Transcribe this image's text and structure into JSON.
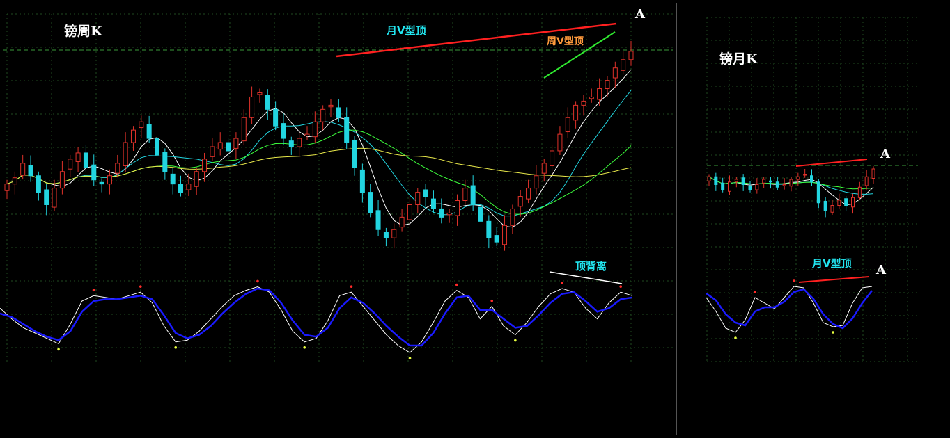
{
  "colors": {
    "background": "#000000",
    "grid": "#1f4a1f",
    "divider": "#8c8c8c",
    "dashed_level": "#3a9a3a",
    "up_candle": "#e0322a",
    "down_candle": "#22d5e0",
    "ma_colors": [
      "#ffffff",
      "#22d5e0",
      "#3dff3d",
      "#e8e84a",
      "#2aa0ff"
    ],
    "osc_fast": "#ffffff",
    "osc_slow": "#1a1aff",
    "red_trend": "#ff2020",
    "green_trend": "#30e830",
    "white_trend": "#ffffff",
    "dot_red": "#ff2a2a",
    "dot_yellow": "#e8ff40"
  },
  "labels": {
    "weekly_title": "镑周K",
    "monthly_title": "镑月K",
    "month_v_top": "月V型顶",
    "week_v_top": "周V型顶",
    "top_divergence": "顶背离",
    "month_v_top_right": "月V型顶",
    "point_a_weekly": "A",
    "point_a_monthly": "A",
    "point_a_monthly_osc": "A"
  },
  "chart_data": [
    {
      "type": "candlestick",
      "title": "镑周K",
      "annotations": [
        "月V型顶",
        "周V型顶",
        "顶背离",
        "A"
      ],
      "series": [
        {
          "name": "candles",
          "close_path": [
            40,
            43,
            50,
            44,
            36,
            30,
            38,
            46,
            52,
            55,
            48,
            42,
            40,
            44,
            50,
            60,
            66,
            70,
            62,
            54,
            46,
            40,
            36,
            40,
            46,
            52,
            58,
            60,
            56,
            62,
            72,
            82,
            84,
            76,
            68,
            62,
            58,
            62,
            64,
            70,
            76,
            78,
            72,
            60,
            48,
            36,
            26,
            18,
            14,
            18,
            24,
            30,
            36,
            34,
            28,
            24,
            26,
            32,
            38,
            30,
            22,
            14,
            12,
            20,
            28,
            34,
            38,
            44,
            50,
            56,
            64,
            72,
            78,
            80,
            82,
            86,
            90,
            96,
            100,
            104
          ]
        }
      ],
      "grid": true
    },
    {
      "type": "line",
      "title": "",
      "series": [
        {
          "name": "fast",
          "values": [
            60,
            48,
            38,
            32,
            26,
            20,
            42,
            68,
            74,
            72,
            70,
            74,
            78,
            66,
            40,
            22,
            24,
            34,
            48,
            62,
            74,
            80,
            84,
            78,
            58,
            34,
            22,
            26,
            46,
            74,
            78,
            62,
            46,
            30,
            18,
            10,
            22,
            44,
            68,
            80,
            72,
            48,
            62,
            40,
            30,
            44,
            62,
            76,
            82,
            78,
            60,
            48,
            66,
            78,
            74
          ]
        },
        {
          "name": "slow",
          "values": [
            54,
            50,
            42,
            34,
            28,
            24,
            34,
            56,
            68,
            70,
            70,
            72,
            74,
            70,
            52,
            32,
            26,
            30,
            40,
            54,
            66,
            76,
            82,
            80,
            66,
            46,
            30,
            28,
            38,
            60,
            72,
            66,
            54,
            40,
            28,
            18,
            18,
            32,
            54,
            72,
            74,
            58,
            58,
            48,
            38,
            40,
            52,
            66,
            76,
            78,
            68,
            56,
            60,
            70,
            72
          ]
        }
      ],
      "grid": true
    },
    {
      "type": "candlestick",
      "title": "镑月K",
      "annotations": [
        "A"
      ],
      "series": [
        {
          "name": "candles",
          "close_path": [
            40,
            34,
            30,
            36,
            38,
            34,
            30,
            34,
            38,
            36,
            32,
            34,
            38,
            40,
            42,
            36,
            20,
            14,
            18,
            22,
            18,
            24,
            32,
            40,
            46
          ]
        }
      ],
      "grid": true
    },
    {
      "type": "line",
      "title": "",
      "annotations": [
        "月V型顶",
        "A"
      ],
      "series": [
        {
          "name": "fast",
          "values": [
            70,
            50,
            26,
            20,
            38,
            70,
            62,
            54,
            70,
            86,
            84,
            62,
            34,
            28,
            30,
            62,
            84,
            86
          ]
        },
        {
          "name": "slow",
          "values": [
            76,
            66,
            46,
            34,
            30,
            50,
            56,
            56,
            64,
            78,
            82,
            68,
            46,
            32,
            26,
            40,
            62,
            80
          ]
        }
      ],
      "grid": true
    }
  ]
}
